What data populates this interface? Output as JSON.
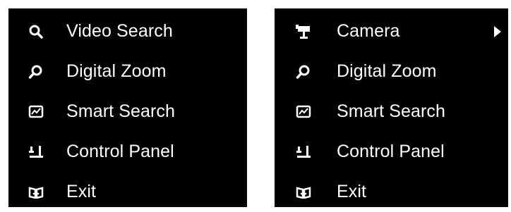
{
  "menus": [
    {
      "items": [
        {
          "label": "Video Search",
          "icon": "search-icon"
        },
        {
          "label": "Digital Zoom",
          "icon": "digital-zoom-icon"
        },
        {
          "label": "Smart Search",
          "icon": "smart-search-icon"
        },
        {
          "label": "Control Panel",
          "icon": "control-panel-icon"
        },
        {
          "label": "Exit",
          "icon": "exit-icon"
        }
      ]
    },
    {
      "items": [
        {
          "label": "Camera",
          "icon": "camera-icon",
          "has_submenu": true
        },
        {
          "label": "Digital Zoom",
          "icon": "digital-zoom-icon"
        },
        {
          "label": "Smart Search",
          "icon": "smart-search-icon"
        },
        {
          "label": "Control Panel",
          "icon": "control-panel-icon"
        },
        {
          "label": "Exit",
          "icon": "exit-icon"
        }
      ]
    }
  ],
  "colors": {
    "menu_background": "#000000",
    "text": "#ffffff",
    "page_background": "#ffffff"
  }
}
